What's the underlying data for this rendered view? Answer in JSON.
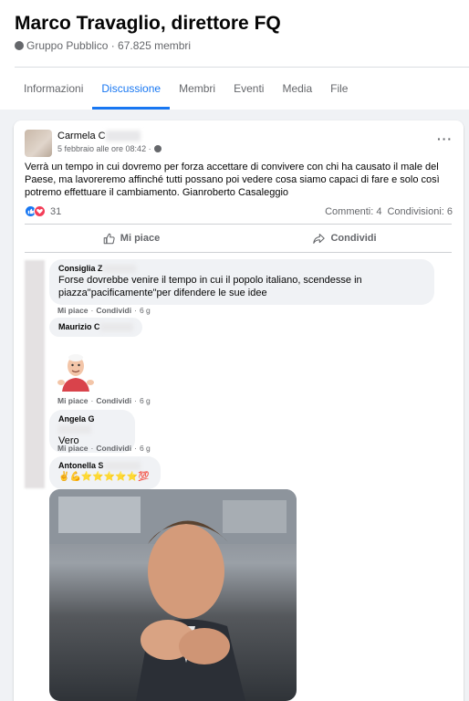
{
  "group": {
    "title": "Marco Travaglio, direttore FQ",
    "meta": "Gruppo Pubblico · 67.825 membri"
  },
  "tabs": [
    "Informazioni",
    "Discussione",
    "Membri",
    "Eventi",
    "Media",
    "File"
  ],
  "post": {
    "author": "Carmela C",
    "time": "5 febbraio alle ore 08:42 ·",
    "text": "Verrà un tempo in cui  dovremo per forza accettare di convivere con chi ha causato il male del Paese, ma lavoreremo affinché tutti possano poi vedere cosa siamo capaci di fare e solo così potremo effettuare il cambiamento. Gianroberto Casaleggio",
    "reactions_count": "31",
    "comments_count": "Commenti: 4",
    "shares_count": "Condivisioni: 6",
    "like_label": "Mi piace",
    "share_label": "Condividi"
  },
  "comments": [
    {
      "author": "Consiglia Z",
      "text": "Forse dovrebbe venire il tempo in cui il popolo italiano, scendesse in piazza\"pacificamente\"per difendere le sue idee",
      "like": "Mi piace",
      "reply": "Condividi",
      "time": "6 g"
    },
    {
      "author": "Maurizio C",
      "text": "",
      "like": "Mi piace",
      "reply": "Condividi",
      "time": "6 g"
    },
    {
      "author": "Angela G",
      "text": "Vero",
      "like": "Mi piace",
      "reply": "Condividi",
      "time": "6 g"
    },
    {
      "author": "Antonella S",
      "text": "✌💪⭐⭐⭐⭐⭐💯",
      "like": "",
      "reply": "",
      "time": ""
    }
  ],
  "colors": {
    "accent": "#1877f2",
    "muted": "#65676b",
    "bubble": "#f0f2f5",
    "love": "#f33e58"
  }
}
